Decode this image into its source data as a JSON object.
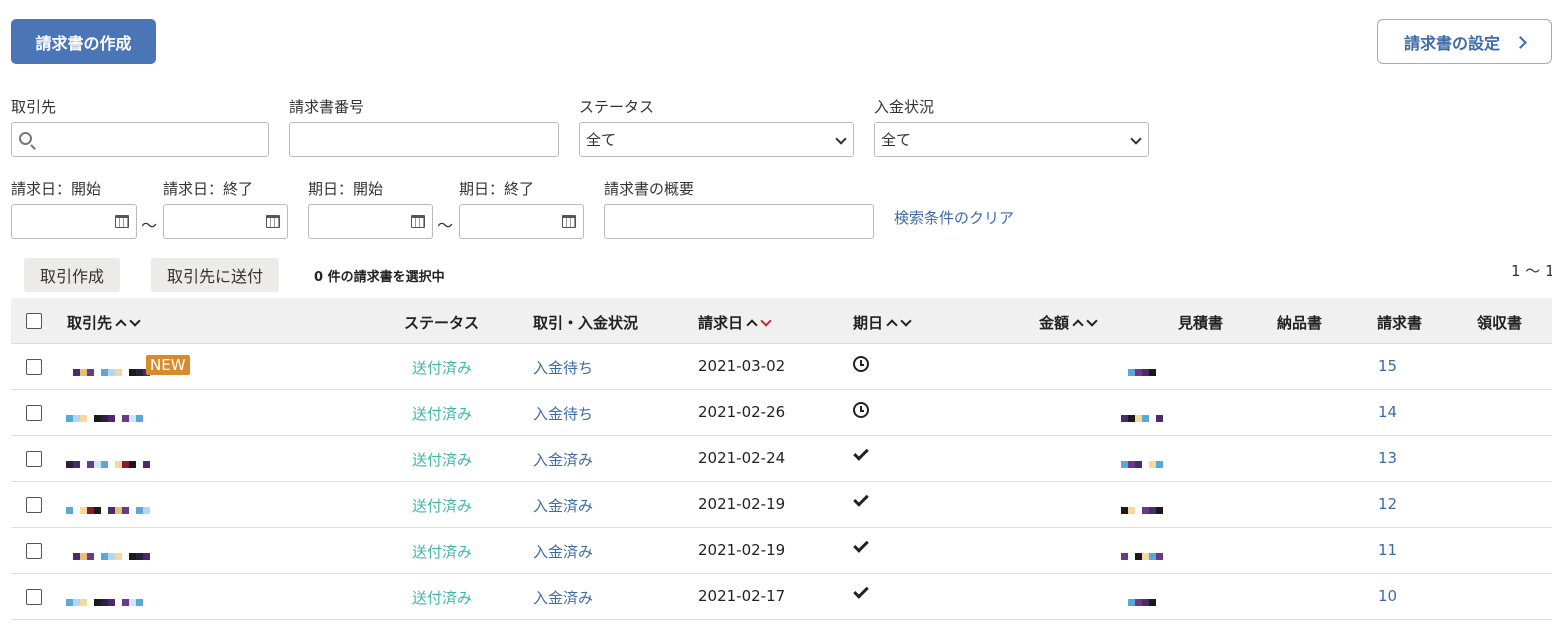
{
  "header": {
    "create_label": "請求書の作成",
    "settings_label": "請求書の設定"
  },
  "filters": {
    "client_label": "取引先",
    "invoice_no_label": "請求書番号",
    "status_label": "ステータス",
    "status_value": "全て",
    "payment_label": "入金状況",
    "payment_value": "全て",
    "invoice_date_start_label": "請求日：開始",
    "invoice_date_end_label": "請求日：終了",
    "due_date_start_label": "期日：開始",
    "due_date_end_label": "期日：終了",
    "summary_label": "請求書の概要",
    "range_sep": "〜",
    "clear_label": "検索条件のクリア"
  },
  "actions": {
    "create_deal_label": "取引作成",
    "send_label": "取引先に送付",
    "selected_text": "0 件の請求書を選択中",
    "pager_text": "1 〜 1"
  },
  "table": {
    "headers": {
      "client": "取引先",
      "status": "ステータス",
      "deal_payment": "取引・入金状況",
      "invoice_date": "請求日",
      "due_date": "期日",
      "amount": "金額",
      "estimate": "見積書",
      "delivery": "納品書",
      "invoice": "請求書",
      "receipt": "領収書"
    },
    "new_badge": "NEW",
    "rows": [
      {
        "status": "送付済み",
        "payment": "入金待ち",
        "date": "2021-03-02",
        "due": "clock-icon",
        "invoice_no": "15"
      },
      {
        "status": "送付済み",
        "payment": "入金待ち",
        "date": "2021-02-26",
        "due": "clock-icon",
        "invoice_no": "14"
      },
      {
        "status": "送付済み",
        "payment": "入金済み",
        "date": "2021-02-24",
        "due": "check-icon",
        "invoice_no": "13"
      },
      {
        "status": "送付済み",
        "payment": "入金済み",
        "date": "2021-02-19",
        "due": "check-icon",
        "invoice_no": "12"
      },
      {
        "status": "送付済み",
        "payment": "入金済み",
        "date": "2021-02-19",
        "due": "check-icon",
        "invoice_no": "11"
      },
      {
        "status": "送付済み",
        "payment": "入金済み",
        "date": "2021-02-17",
        "due": "check-icon",
        "invoice_no": "10"
      }
    ]
  },
  "colors": {
    "primary": "#4a76b8",
    "link": "#3f6ba8",
    "status_teal": "#3fb8a8",
    "badge_orange": "#d98a2a",
    "sort_active_red": "#c8283c"
  }
}
